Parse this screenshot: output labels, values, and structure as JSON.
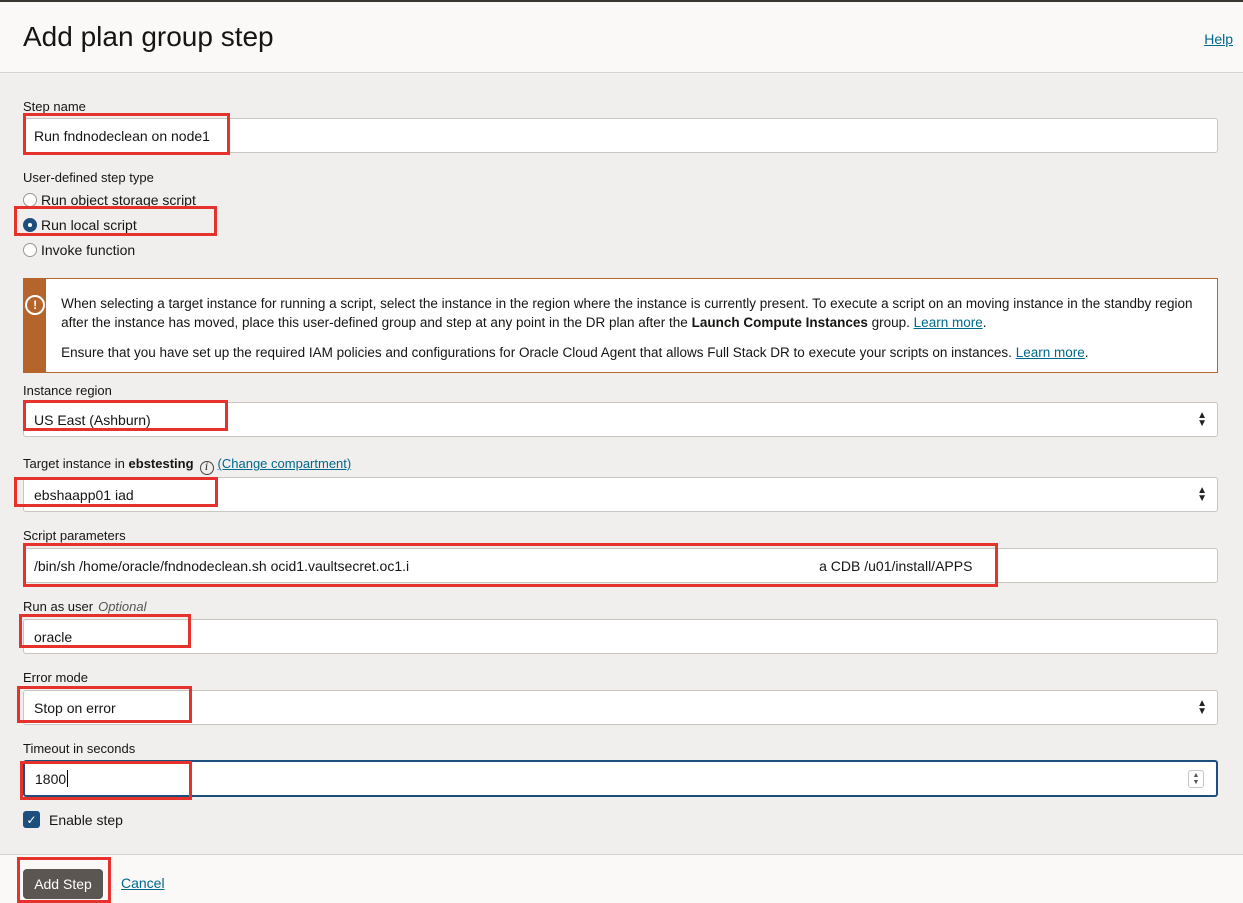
{
  "header": {
    "title": "Add plan group step",
    "help_label": "Help"
  },
  "form": {
    "step_name": {
      "label": "Step name",
      "value": "Run fndnodeclean on node1"
    },
    "step_type": {
      "label": "User-defined step type",
      "options": [
        "Run object storage script",
        "Run local script",
        "Invoke function"
      ],
      "selected": "Run local script"
    },
    "notice": {
      "icon": "alert-circle-icon",
      "p1_text": "When selecting a target instance for running a script, select the instance in the region where the instance is currently present. To execute a script on an moving instance in the standby region after the instance has moved, place this user-defined group and step at any point in the DR plan after the",
      "p1_bold": "Launch Compute Instances",
      "p1_after": "group.",
      "p1_link": "Learn more",
      "p2_text": "Ensure that you have set up the required IAM policies and configurations for Oracle Cloud Agent that allows Full Stack DR to execute your scripts on instances.",
      "p2_link": "Learn more"
    },
    "instance_region": {
      "label": "Instance region",
      "value": "US East (Ashburn)"
    },
    "target_instance": {
      "label_prefix": "Target instance in",
      "compartment": "ebstesting",
      "change_link": "(Change compartment)",
      "value": "ebshaapp01 iad"
    },
    "script_parameters": {
      "label": "Script parameters",
      "value_start": "/bin/sh /home/oracle/fndnodeclean.sh ocid1.vaultsecret.oc1.i",
      "value_end": "a CDB /u01/install/APPS"
    },
    "run_as_user": {
      "label": "Run as user",
      "optional": "Optional",
      "value": "oracle"
    },
    "error_mode": {
      "label": "Error mode",
      "value": "Stop on error"
    },
    "timeout": {
      "label": "Timeout in seconds",
      "value": "1800"
    },
    "enable_step": {
      "label": "Enable step",
      "checked": true
    }
  },
  "footer": {
    "primary_label": "Add Step",
    "cancel_label": "Cancel"
  },
  "colors": {
    "accent": "#1e4e7c",
    "link": "#00688c",
    "warning": "#b5652c",
    "highlight": "#e5322d"
  }
}
